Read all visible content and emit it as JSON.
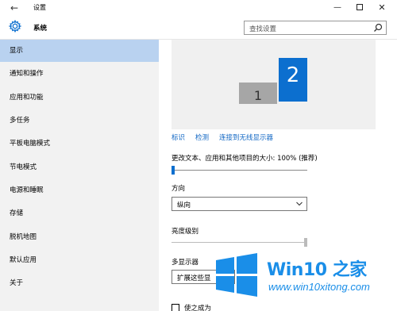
{
  "window": {
    "title": "设置",
    "back_glyph": "←",
    "minimize_glyph": "—",
    "close_glyph": "✕"
  },
  "header": {
    "section_title": "系统",
    "search_placeholder": "查找设置"
  },
  "sidebar": {
    "items": [
      {
        "label": "显示",
        "active": true
      },
      {
        "label": "通知和操作"
      },
      {
        "label": "应用和功能"
      },
      {
        "label": "多任务"
      },
      {
        "label": "平板电脑模式"
      },
      {
        "label": "节电模式"
      },
      {
        "label": "电源和睡眠"
      },
      {
        "label": "存储"
      },
      {
        "label": "脱机地图"
      },
      {
        "label": "默认应用"
      },
      {
        "label": "关于"
      }
    ]
  },
  "main": {
    "monitors": [
      {
        "number": "1",
        "color": "#a6a6a6"
      },
      {
        "number": "2",
        "color": "#0c6fcf",
        "selected": true
      }
    ],
    "links": [
      "标识",
      "检测",
      "连接到无线显示器"
    ],
    "scale_label": "更改文本、应用和其他项目的大小: 100% (推荐)",
    "scale_level": 0,
    "orientation_label": "方向",
    "orientation_value": "纵向",
    "brightness_label": "亮度级别",
    "brightness_level": 1.0,
    "multi_display_label": "多显示器",
    "multi_display_value": "扩展这些显",
    "checkbox_label": "使之成为"
  },
  "watermark": {
    "title": "Win10 之家",
    "url": "www.win10xitong.com"
  },
  "colors": {
    "accent": "#0c6fcf",
    "nav_active": "#b9d2f0",
    "sidebar_bg": "#f2f2f2",
    "link": "#1167c4"
  }
}
